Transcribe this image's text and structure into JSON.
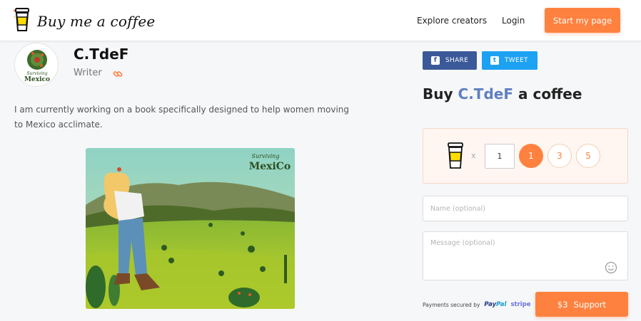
{
  "header": {
    "logo_text": "Buy me a coffee",
    "nav": [
      "Explore creators",
      "Login"
    ],
    "cta_label": "Start my page"
  },
  "creator": {
    "name": "C.TdeF",
    "role": "Writer",
    "about": "I am currently working on a book specifically designed to help women moving to Mexico acclimate.",
    "avatar_text": {
      "line1": "Surviving",
      "line2": "Mexico"
    },
    "artwork_text": {
      "line1": "Surviving",
      "line2": "MexiCo"
    }
  },
  "share": {
    "facebook_label": "SHARE",
    "twitter_label": "TWEET"
  },
  "support_panel": {
    "title_prefix": "Buy",
    "title_name": "C.TdeF",
    "title_suffix": "a coffee",
    "multiplier": "x",
    "quantity_value": "1",
    "quantity_options": [
      "1",
      "3",
      "5"
    ],
    "selected_option": "1",
    "name_placeholder": "Name (optional)",
    "message_placeholder": "Message (optional)",
    "secured_text": "Payments secured by",
    "paypal_text": {
      "pay": "Pay",
      "pal": "Pal"
    },
    "stripe_text": "stripe",
    "support_amount": "$3",
    "support_label": "Support"
  },
  "colors": {
    "accent": "#ff813f",
    "facebook": "#3b5998",
    "twitter": "#1da1f2",
    "name_accent": "#5f7fbf"
  },
  "icons": [
    "coffee-cup-icon",
    "link-icon",
    "facebook-icon",
    "twitter-icon",
    "smiley-icon"
  ]
}
